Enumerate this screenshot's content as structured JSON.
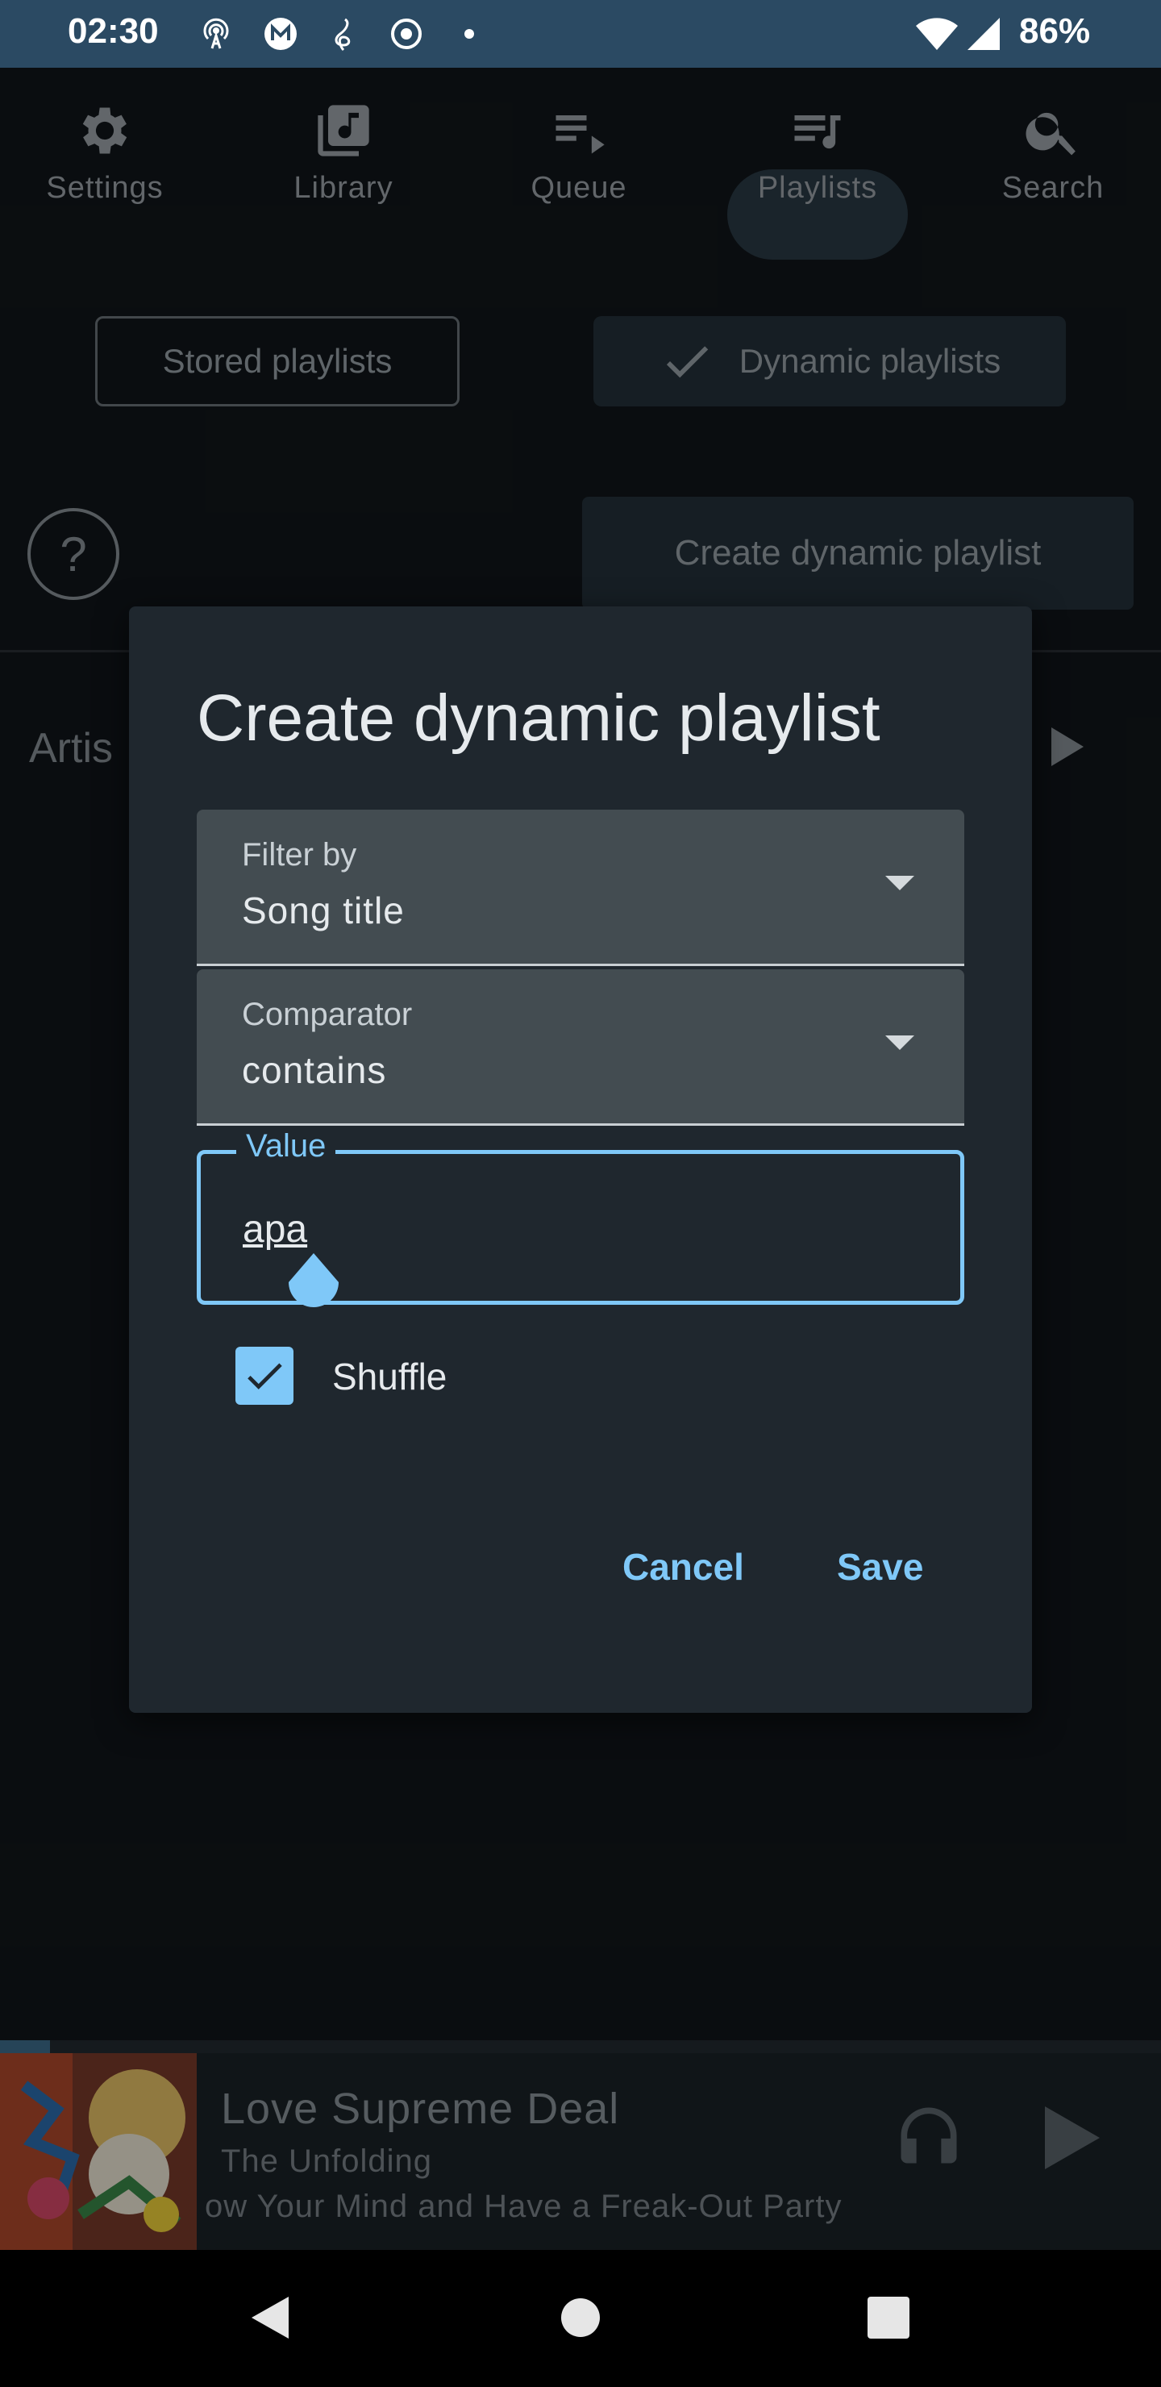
{
  "status_bar": {
    "time": "02:30",
    "icons": [
      "hotspot-icon",
      "m-icon",
      "music-clef-icon",
      "record-icon",
      "dot-icon"
    ],
    "battery": "86%",
    "right_icons": [
      "wifi-icon",
      "signal-icon"
    ]
  },
  "top_nav": {
    "items": [
      {
        "label": "Settings",
        "icon": "gear-icon"
      },
      {
        "label": "Library",
        "icon": "library-icon"
      },
      {
        "label": "Queue",
        "icon": "queue-icon"
      },
      {
        "label": "Playlists",
        "icon": "playlist-icon",
        "active": true
      },
      {
        "label": "Search",
        "icon": "search-icon"
      }
    ]
  },
  "playlist_tabs": {
    "stored": "Stored playlists",
    "dynamic": "Dynamic playlists"
  },
  "help_symbol": "?",
  "create_button_label": "Create dynamic playlist",
  "background_row_text": "Artis",
  "dialog": {
    "title": "Create dynamic playlist",
    "filter_label": "Filter by",
    "filter_value": "Song title",
    "comparator_label": "Comparator",
    "comparator_value": "contains",
    "value_label": "Value",
    "value_text": "apa",
    "shuffle_label": "Shuffle",
    "shuffle_checked": true,
    "cancel_label": "Cancel",
    "save_label": "Save"
  },
  "player": {
    "title": "Love Supreme Deal",
    "artist": "The Unfolding",
    "album": "ow Your Mind and Have a Freak-Out Party",
    "progress_fraction": 0.04
  },
  "colors": {
    "accent": "#7fc8f8",
    "status_bar": "#2b4a63",
    "background": "#11161a",
    "dialog": "#1f272e"
  }
}
